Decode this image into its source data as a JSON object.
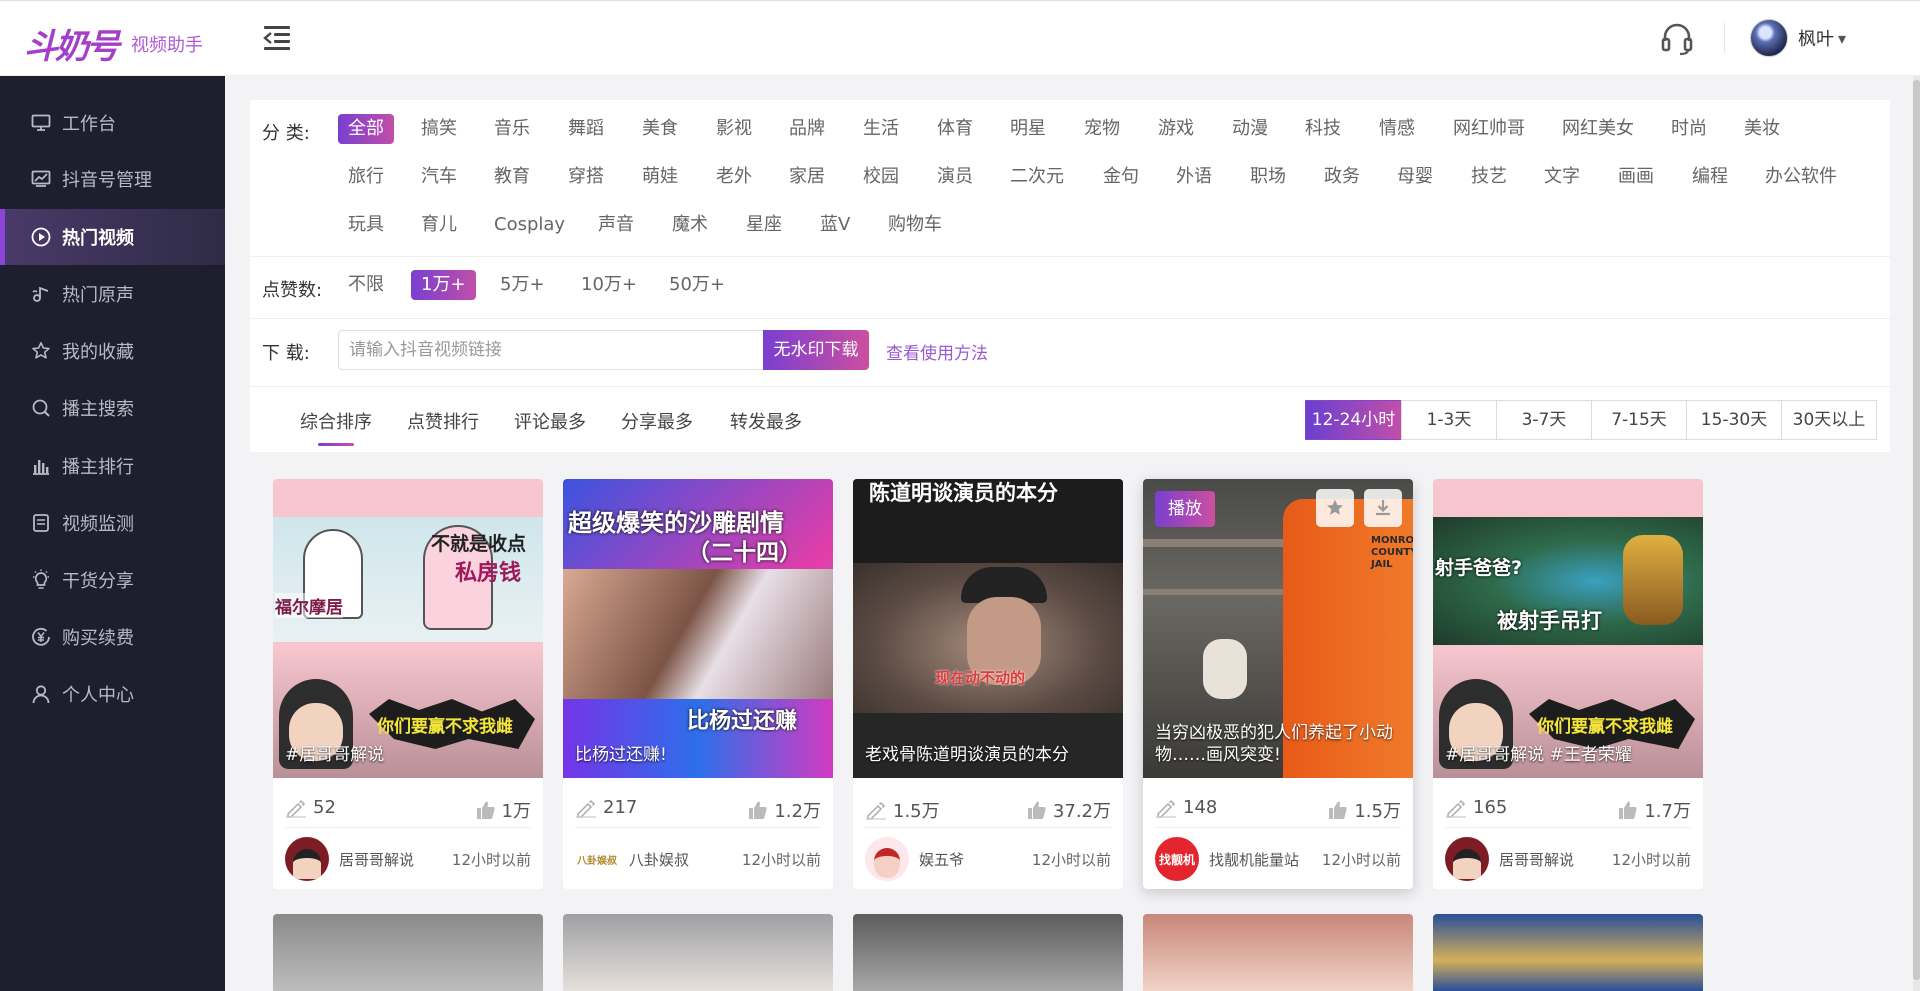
{
  "app": {
    "logo_text": "斗奶号",
    "logo_sub": "视频助手"
  },
  "user": {
    "name": "枫叶",
    "caret": "▾"
  },
  "sidebar": {
    "items": [
      {
        "label": "工作台",
        "icon": "monitor-icon"
      },
      {
        "label": "抖音号管理",
        "icon": "chart-screen-icon"
      },
      {
        "label": "热门视频",
        "icon": "play-circle-icon",
        "active": true
      },
      {
        "label": "热门原声",
        "icon": "music-icon"
      },
      {
        "label": "我的收藏",
        "icon": "star-icon"
      },
      {
        "label": "播主搜索",
        "icon": "search-icon"
      },
      {
        "label": "播主排行",
        "icon": "bar-chart-icon"
      },
      {
        "label": "视频监测",
        "icon": "document-icon"
      },
      {
        "label": "干货分享",
        "icon": "bulb-icon"
      },
      {
        "label": "购买续费",
        "icon": "yen-icon"
      },
      {
        "label": "个人中心",
        "icon": "user-icon"
      }
    ]
  },
  "filters": {
    "category_label": "分  类:",
    "categories_row1": [
      "全部",
      "搞笑",
      "音乐",
      "舞蹈",
      "美食",
      "影视",
      "品牌",
      "生活",
      "体育",
      "明星",
      "宠物",
      "游戏",
      "动漫",
      "科技",
      "情感",
      "网红帅哥",
      "网红美女",
      "时尚",
      "美妆"
    ],
    "categories_row2": [
      "旅行",
      "汽车",
      "教育",
      "穿搭",
      "萌娃",
      "老外",
      "家居",
      "校园",
      "演员",
      "二次元",
      "金句",
      "外语",
      "职场",
      "政务",
      "母婴",
      "技艺",
      "文字",
      "画画",
      "编程",
      "办公软件"
    ],
    "categories_row3": [
      "玩具",
      "育儿",
      "Cosplay",
      "声音",
      "魔术",
      "星座",
      "蓝V",
      "购物车"
    ],
    "active_category": "全部",
    "likes_label": "点赞数:",
    "likes_options": [
      "不限",
      "1万+",
      "5万+",
      "10万+",
      "50万+"
    ],
    "active_likes": "1万+",
    "download_label": "下  载:",
    "download_placeholder": "请输入抖音视频链接",
    "download_button": "无水印下载",
    "help_link": "查看使用方法"
  },
  "sort_tabs": [
    "综合排序",
    "点赞排行",
    "评论最多",
    "分享最多",
    "转发最多"
  ],
  "active_sort": "综合排序",
  "time_ranges": [
    "12-24小时",
    "1-3天",
    "3-7天",
    "7-15天",
    "15-30天",
    "30天以上"
  ],
  "active_time": "12-24小时",
  "cards": [
    {
      "caption": "#居哥哥解说",
      "comments": "52",
      "likes": "1万",
      "author": "居哥哥解说",
      "time": "12小时以前",
      "overlay_top": "不就是收点",
      "overlay_top2": "私房钱",
      "overlay_left": "福尔摩居",
      "overlay_bottom": "你们要赢不求我雌",
      "avatar_text": ""
    },
    {
      "caption": "比杨过还赚!",
      "comments": "217",
      "likes": "1.2万",
      "author": "八卦娱叔",
      "time": "12小时以前",
      "overlay_top": "超级爆笑的沙雕剧情",
      "overlay_top2": "（二十四）",
      "overlay_bottom": "比杨过还赚",
      "avatar_text": "八卦娱叔"
    },
    {
      "caption": "老戏骨陈道明谈演员的本分",
      "comments": "1.5万",
      "likes": "37.2万",
      "author": "娱五爷",
      "time": "12小时以前",
      "overlay_top": "陈道明谈演员的本分",
      "overlay_sub": "现在动不动的",
      "avatar_text": ""
    },
    {
      "caption": "当穷凶极恶的犯人们养起了小动物……画风突变!",
      "comments": "148",
      "likes": "1.5万",
      "author": "找靓机能量站",
      "time": "12小时以前",
      "play_label": "播放",
      "overlay_shirt": "MONROE COUNTY JAIL",
      "avatar_text": "找靓机"
    },
    {
      "caption": "#居哥哥解说 #王者荣耀",
      "comments": "165",
      "likes": "1.7万",
      "author": "居哥哥解说",
      "time": "12小时以前",
      "overlay_top": "射手爸爸?",
      "overlay_sub": "被射手吊打",
      "overlay_bottom": "你们要赢不求我雌",
      "avatar_text": ""
    }
  ],
  "colors": {
    "accent": "#8e44d8",
    "accent2": "#cc4fa0",
    "sidebar_bg": "#1f1e2e"
  }
}
